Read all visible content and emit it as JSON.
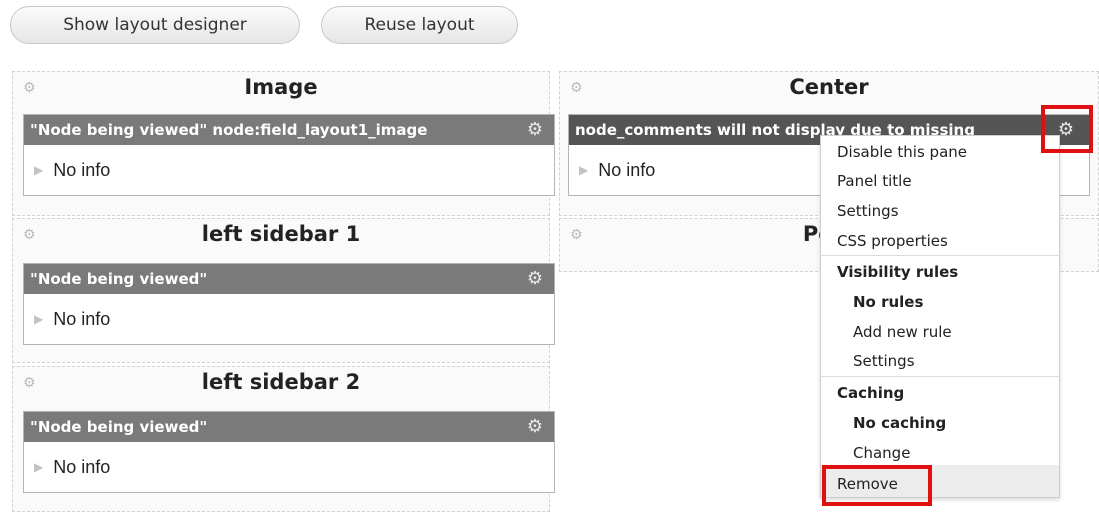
{
  "toolbar": {
    "show_layout_designer": "Show layout designer",
    "reuse_layout": "Reuse layout"
  },
  "regions": {
    "image": {
      "title": "Image",
      "pane": {
        "title": "\"Node being viewed\" node:field_layout1_image",
        "body": "No info"
      }
    },
    "left_sidebar_1": {
      "title": "left sidebar 1",
      "pane": {
        "title": "\"Node being viewed\"",
        "body": "No info"
      }
    },
    "left_sidebar_2": {
      "title": "left sidebar 2",
      "pane": {
        "title": "\"Node being viewed\"",
        "body": "No info"
      }
    },
    "center": {
      "title": "Center",
      "pane": {
        "title": "node_comments will not display due to missing",
        "body": "No info"
      }
    },
    "post": {
      "title": "Post"
    }
  },
  "context_menu": {
    "disable_pane": "Disable this pane",
    "panel_title": "Panel title",
    "settings": "Settings",
    "css_properties": "CSS properties",
    "visibility_heading": "Visibility rules",
    "no_rules": "No rules",
    "add_new_rule": "Add new rule",
    "visibility_settings": "Settings",
    "caching_heading": "Caching",
    "no_caching": "No caching",
    "change": "Change",
    "remove": "Remove"
  },
  "colors": {
    "highlight": "#e01010",
    "pane_header": "#7a7a7a"
  }
}
